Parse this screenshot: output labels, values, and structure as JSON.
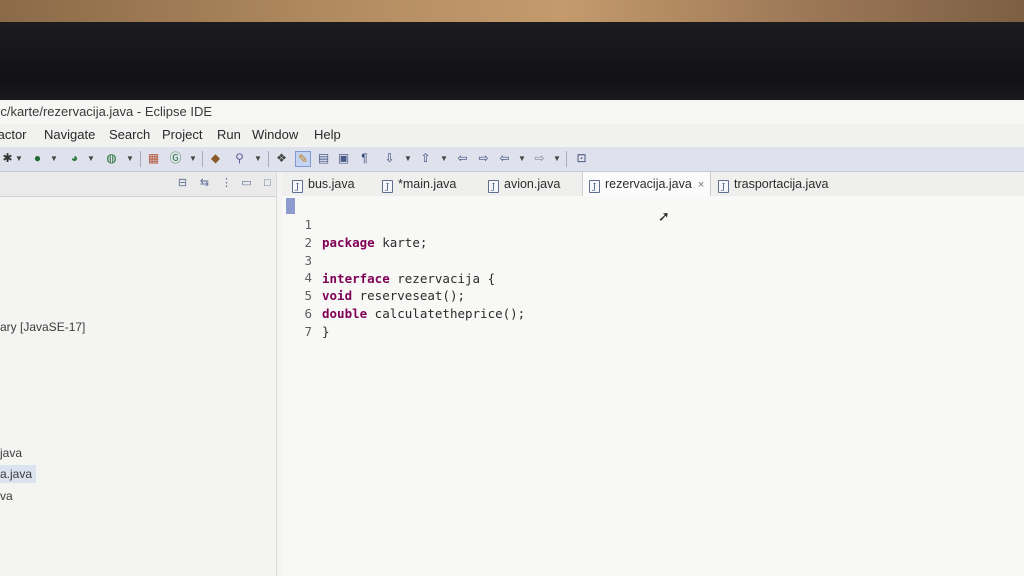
{
  "window": {
    "title": "rc/karte/rezervacija.java - Eclipse IDE"
  },
  "menu": [
    "factor",
    "Navigate",
    "Search",
    "Project",
    "Run",
    "Window",
    "Help"
  ],
  "toolbar_icons": [
    "debug-icon",
    "run-icon",
    "coverage-icon",
    "external-tools-icon",
    "new-java-class-icon",
    "new-package-icon",
    "open-type-icon",
    "search-icon",
    "toggle-mark-occurrences-icon",
    "toggle-block-selection-icon",
    "word-wrap-icon",
    "show-whitespace-icon",
    "next-annotation-icon",
    "prev-annotation-icon",
    "back-icon",
    "forward-icon",
    "pin-editor-icon"
  ],
  "explorer": {
    "items": [
      {
        "label": "ary [JavaSE-17]",
        "selected": false
      },
      {
        "label": "java",
        "selected": false
      },
      {
        "label": "a.java",
        "selected": true
      },
      {
        "label": "va",
        "selected": false
      }
    ]
  },
  "editor": {
    "tabs": [
      {
        "label": "bus.java",
        "active": false,
        "dirty": false
      },
      {
        "label": "*main.java",
        "active": false,
        "dirty": true
      },
      {
        "label": "avion.java",
        "active": false,
        "dirty": false
      },
      {
        "label": "rezervacija.java",
        "active": true,
        "dirty": false
      },
      {
        "label": "trasportacija.java",
        "active": false,
        "dirty": false
      }
    ],
    "close_glyph": "×",
    "file_icon_glyph": "J",
    "lines": [
      {
        "num": "1",
        "keyword": "package",
        "rest": " karte;"
      },
      {
        "num": "2",
        "keyword": "",
        "rest": ""
      },
      {
        "num": "3",
        "keyword": "interface",
        "rest": " rezervacija {"
      },
      {
        "num": "4",
        "keyword": "void",
        "rest": " reserveseat();"
      },
      {
        "num": "5",
        "keyword": "double",
        "rest": " calculatetheprice();"
      },
      {
        "num": "6",
        "keyword": "",
        "rest": "}"
      },
      {
        "num": "7",
        "keyword": "",
        "rest": ""
      }
    ]
  },
  "colors": {
    "keyword": "#7f0055",
    "toolbar_bg": "#dfe2ec",
    "selection": "#dbe3ef"
  }
}
